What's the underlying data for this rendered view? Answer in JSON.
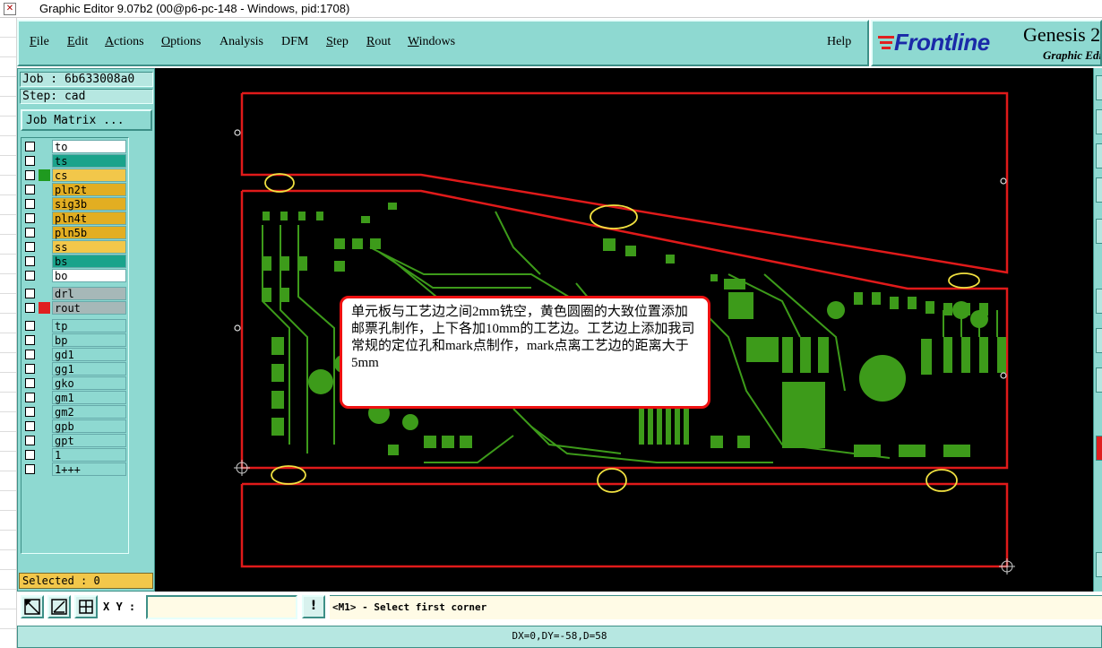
{
  "window": {
    "title": "Graphic Editor 9.07b2 (00@p6-pc-148 - Windows, pid:1708)"
  },
  "menu": {
    "items": [
      {
        "label": "File",
        "underline": "F",
        "rest": "ile"
      },
      {
        "label": "Edit",
        "underline": "E",
        "rest": "dit"
      },
      {
        "label": "Actions",
        "underline": "A",
        "rest": "ctions"
      },
      {
        "label": "Options",
        "underline": "O",
        "rest": "ptions"
      },
      {
        "label": "Analysis",
        "underline": "",
        "rest": "Analysis"
      },
      {
        "label": "DFM",
        "underline": "",
        "rest": "DFM"
      },
      {
        "label": "Step",
        "underline": "S",
        "rest": "tep"
      },
      {
        "label": "Rout",
        "underline": "R",
        "rest": "out"
      },
      {
        "label": "Windows",
        "underline": "W",
        "rest": "indows"
      }
    ],
    "help": "Help"
  },
  "branding": {
    "logo": "Frontline",
    "product": "Genesis 2",
    "subtitle": "Graphic Editor",
    "accent": "#1a2aa8",
    "logo_mark_color": "#e02020"
  },
  "job_panel": {
    "job": "Job : 6b633008a0",
    "step": "Step: cad",
    "job_matrix_button": "Job Matrix ...",
    "selected": "Selected : 0"
  },
  "layers": [
    {
      "name": "to",
      "color": "#ffffff",
      "mark": "",
      "flag": "✎"
    },
    {
      "name": "ts",
      "color": "#1aa38b",
      "mark": "",
      "flag": ""
    },
    {
      "name": "cs",
      "color": "#f2c74a",
      "mark": "#1f9a1f",
      "flag": "✎"
    },
    {
      "name": "pln2t",
      "color": "#e2ae22",
      "mark": "",
      "flag": ""
    },
    {
      "name": "sig3b",
      "color": "#e2ae22",
      "mark": "",
      "flag": ""
    },
    {
      "name": "pln4t",
      "color": "#e2ae22",
      "mark": "",
      "flag": ""
    },
    {
      "name": "pln5b",
      "color": "#e2ae22",
      "mark": "",
      "flag": ""
    },
    {
      "name": "ss",
      "color": "#f2c74a",
      "mark": "",
      "flag": ""
    },
    {
      "name": "bs",
      "color": "#1aa38b",
      "mark": "",
      "flag": ""
    },
    {
      "name": "bo",
      "color": "#ffffff",
      "mark": "",
      "flag": ""
    },
    {
      "name": "drl",
      "color": "#a6b8b8",
      "mark": "",
      "flag": ""
    },
    {
      "name": "rout",
      "color": "#a6b8b8",
      "mark": "#e02020",
      "flag": "▣"
    },
    {
      "name": "tp",
      "color": "#8ed9d1",
      "mark": "",
      "flag": ""
    },
    {
      "name": "bp",
      "color": "#8ed9d1",
      "mark": "",
      "flag": ""
    },
    {
      "name": "gd1",
      "color": "#8ed9d1",
      "mark": "",
      "flag": "✎"
    },
    {
      "name": "gg1",
      "color": "#8ed9d1",
      "mark": "",
      "flag": ""
    },
    {
      "name": "gko",
      "color": "#8ed9d1",
      "mark": "",
      "flag": ""
    },
    {
      "name": "gm1",
      "color": "#8ed9d1",
      "mark": "",
      "flag": "✎"
    },
    {
      "name": "gm2",
      "color": "#8ed9d1",
      "mark": "",
      "flag": "✎"
    },
    {
      "name": "gpb",
      "color": "#8ed9d1",
      "mark": "",
      "flag": ""
    },
    {
      "name": "gpt",
      "color": "#8ed9d1",
      "mark": "",
      "flag": ""
    },
    {
      "name": "1",
      "color": "#8ed9d1",
      "mark": "",
      "flag": ""
    },
    {
      "name": "1+++",
      "color": "#8ed9d1",
      "mark": "",
      "flag": ""
    }
  ],
  "annotation": {
    "text": "单元板与工艺边之间2mm铣空，黄色圆圈的大致位置添加邮票孔制作，上下各加10mm的工艺边。工艺边上添加我司常规的定位孔和mark点制作，mark点离工艺边的距离大于5mm"
  },
  "toolbar": {
    "xy_label": "X Y :",
    "xy_value": "",
    "excl": "!",
    "prompt": "<M1> - Select first corner"
  },
  "status": {
    "text": "DX=0,DY=-58,D=58"
  },
  "colors": {
    "panel": "#8ed9d1",
    "canvas": "#000000",
    "outline": "#e01a1a",
    "copper": "#3d9b1a",
    "marker": "#f0e040"
  }
}
